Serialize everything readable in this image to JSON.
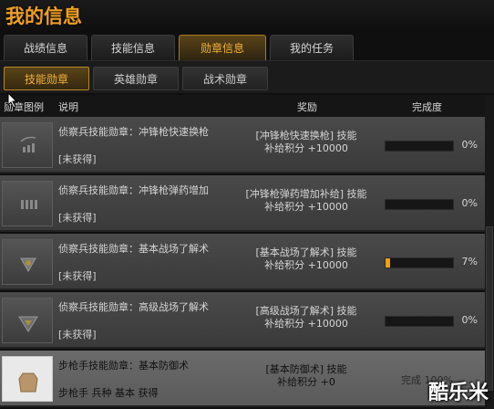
{
  "window": {
    "title": "我的信息"
  },
  "tabs": [
    {
      "label": "战绩信息",
      "active": false
    },
    {
      "label": "技能信息",
      "active": false
    },
    {
      "label": "勋章信息",
      "active": true
    },
    {
      "label": "我的任务",
      "active": false
    }
  ],
  "subtabs": [
    {
      "label": "技能勋章",
      "active": true
    },
    {
      "label": "英雄勋章",
      "active": false
    },
    {
      "label": "战术勋章",
      "active": false
    }
  ],
  "table_header": {
    "icon_col": "勋章图例",
    "desc_col": "说明",
    "reward_col": "奖励",
    "progress_col": "完成度"
  },
  "rows": [
    {
      "desc": "侦察兵技能勋章：冲锋枪快速换枪",
      "status": "[未获得]",
      "reward_line1": "[冲锋枪快速换枪] 技能",
      "reward_line2": "补给积分 +10000",
      "progress": 0,
      "progress_text": "0%",
      "highlight": false
    },
    {
      "desc": "侦察兵技能勋章：冲锋枪弹药增加",
      "status": "[未获得]",
      "reward_line1": "[冲锋枪弹药增加补给] 技能",
      "reward_line2": "补给积分 +10000",
      "progress": 0,
      "progress_text": "0%",
      "highlight": false
    },
    {
      "desc": "侦察兵技能勋章：基本战场了解术",
      "status": "[未获得]",
      "reward_line1": "[基本战场了解术] 技能",
      "reward_line2": "补给积分 +10000",
      "progress": 0.07,
      "progress_text": "7%",
      "highlight": false
    },
    {
      "desc": "侦察兵技能勋章：高级战场了解术",
      "status": "[未获得]",
      "reward_line1": "[高级战场了解术] 技能",
      "reward_line2": "补给积分 +10000",
      "progress": 0,
      "progress_text": "0%",
      "highlight": false
    },
    {
      "desc": "步枪手技能勋章：基本防御术",
      "status": "步枪手 兵种 基本 获得",
      "reward_line1": "[基本防御术] 技能",
      "reward_line2": "补给积分 +0",
      "progress": 1,
      "progress_text": "完成 100%",
      "highlight": true
    }
  ],
  "watermark": "酷乐米",
  "colors": {
    "accent": "#f0a020",
    "bar_fill": "#f0a010"
  }
}
